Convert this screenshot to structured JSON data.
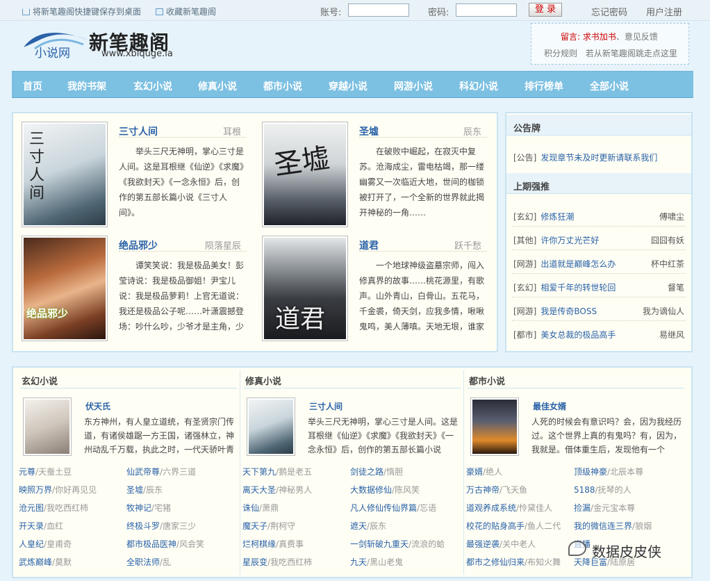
{
  "topbar": {
    "save_shortcut": "将新笔趣阁快捷键保存到桌面",
    "bookmark": "收藏新笔趣阁",
    "account_label": "账号:",
    "password_label": "密码:",
    "login_button": "登 录",
    "forgot_password": "忘记密码",
    "register": "用户注册"
  },
  "header": {
    "logo_small": "小说网",
    "logo_big": "新笔趣阁",
    "logo_url": "www.xbiquge.la",
    "notice_label": "留言:",
    "notice_link1": "求书加书",
    "notice_sep": "、",
    "notice_link2": "意见反馈",
    "notice_line2_a": "积分规则",
    "notice_line2_b": "若从新笔趣阁跳走点这里"
  },
  "nav": [
    "首页",
    "我的书架",
    "玄幻小说",
    "修真小说",
    "都市小说",
    "穿越小说",
    "网游小说",
    "科幻小说",
    "排行榜单",
    "全部小说"
  ],
  "featured": [
    {
      "title": "三寸人间",
      "author": "耳根",
      "desc": "举头三尺无神明，掌心三寸是人间。这是耳根继《仙逆》《求魔》《我欲封天》《一念永恒》后，创作的第五部长篇小说《三寸人间》。"
    },
    {
      "title": "圣墟",
      "author": "辰东",
      "desc": "在破败中崛起，在寂灭中复苏。沧海成尘，雷电枯竭，那一缕幽雾又一次临近大地，世间的枷锁被打开了，一个全新的世界就此揭开神秘的一角……"
    },
    {
      "title": "绝品邪少",
      "author": "陨落星辰",
      "desc": "谭笑笑说：我是极品美女！彭莹诗说：我是极品御姐！尹宝儿说：我是极品萝莉！上官无道说：我还是极品公子呢……叶潇震撼登场：吵什么吵，少爷才是主角，少爷的口号是践踏一切极品，只做人"
    },
    {
      "title": "道君",
      "author": "跃千愁",
      "desc": "一个地球神级盗墓宗师，闯入修真界的故事……桃花源里，有歌声。山外青山，白骨山。五花马，千金裘，倚天剑，应我多情，啾啾鬼鸣，美人薄嗔。天地无垠，谁家旗鼓，碧落黄泉，万古高楼。为义"
    }
  ],
  "side": {
    "notice_title": "公告牌",
    "notice_cat": "[公告]",
    "notice_text": "发现章节未及时更新请联系我们",
    "recommend_title": "上期强推",
    "items": [
      {
        "cat": "[玄幻]",
        "name": "修炼狂潮",
        "author": "傅啸尘"
      },
      {
        "cat": "[其他]",
        "name": "许你万丈光芒好",
        "author": "囧囧有妖"
      },
      {
        "cat": "[网游]",
        "name": "出道就是巅峰怎么办",
        "author": "杯中红茶"
      },
      {
        "cat": "[玄幻]",
        "name": "相爱千年的转世轮回",
        "author": "督笔"
      },
      {
        "cat": "[网游]",
        "name": "我是传奇BOSS",
        "author": "我为谪仙人"
      },
      {
        "cat": "[都市]",
        "name": "美女总裁的极品高手",
        "author": "易继风"
      }
    ]
  },
  "categories": [
    {
      "title": "玄幻小说",
      "top_title": "伏天氏",
      "top_desc": "东方神州，有人皇立道统，有圣贤宗门传道，有诸侯雄踞一方王国，诸强林立，神州动乱千万载，执此之时，一代天骄叶青",
      "rows": [
        [
          {
            "b": "元尊",
            "a": "天蚕土豆"
          },
          {
            "b": "仙武帝尊",
            "a": "六界三道"
          }
        ],
        [
          {
            "b": "映照万界",
            "a": "你好再见见"
          },
          {
            "b": "圣墟",
            "a": "辰东"
          }
        ],
        [
          {
            "b": "沧元图",
            "a": "我吃西红柿"
          },
          {
            "b": "牧神记",
            "a": "宅猪"
          }
        ],
        [
          {
            "b": "开天录",
            "a": "血红"
          },
          {
            "b": "终极斗罗",
            "a": "唐家三少"
          }
        ],
        [
          {
            "b": "人皇纪",
            "a": "皇甫奇"
          },
          {
            "b": "都市极品医神",
            "a": "风会笑"
          }
        ],
        [
          {
            "b": "武炼巅峰",
            "a": "莫默"
          },
          {
            "b": "全职法师",
            "a": "乱"
          }
        ]
      ]
    },
    {
      "title": "修真小说",
      "top_title": "三寸人间",
      "top_desc": "举头三尺无神明，掌心三寸是人间。这是耳根继《仙逆》《求魔》《我欲封天》《一念永恒》后，创作的第五部长篇小说",
      "rows": [
        [
          {
            "b": "天下第九",
            "a": "鹅是老五"
          },
          {
            "b": "剑徒之路",
            "a": "惰胆"
          }
        ],
        [
          {
            "b": "离天大圣",
            "a": "神秘男人"
          },
          {
            "b": "大数据修仙",
            "a": "陈风笑"
          }
        ],
        [
          {
            "b": "诛仙",
            "a": "萧鼎"
          },
          {
            "b": "凡人修仙传仙界篇",
            "a": "忘语"
          }
        ],
        [
          {
            "b": "魔天子",
            "a": "荆柯守"
          },
          {
            "b": "遮天",
            "a": "辰东"
          }
        ],
        [
          {
            "b": "烂柯棋缘",
            "a": "真费事"
          },
          {
            "b": "一剑斩破九重天",
            "a": "流浪的蛤"
          }
        ],
        [
          {
            "b": "星辰变",
            "a": "我吃西红柿"
          },
          {
            "b": "九天",
            "a": "黑山老鬼"
          }
        ]
      ]
    },
    {
      "title": "都市小说",
      "top_title": "最佳女婿",
      "top_desc": "人死的时候会有意识吗？会，因为我经历过。这个世界上真的有鬼吗？有，因为，我就是。借体重生后，发现他有一个",
      "rows": [
        [
          {
            "b": "豪婿",
            "a": "绝人"
          },
          {
            "b": "顶级神豪",
            "a": "北辰本尊"
          }
        ],
        [
          {
            "b": "万古神帝",
            "a": "飞天鱼"
          },
          {
            "b": "5188",
            "a": "抚琴的人"
          }
        ],
        [
          {
            "b": "道观养成系统",
            "a": "怜黛佳人"
          },
          {
            "b": "捡漏",
            "a": "金元宝本尊"
          }
        ],
        [
          {
            "b": "校花的贴身高手",
            "a": "鱼人二代"
          },
          {
            "b": "我的微信连三界",
            "a": "狼烟"
          }
        ],
        [
          {
            "b": "最强逆袭",
            "a": "关中老人"
          },
          {
            "b": "直播",
            "a": ""
          }
        ],
        [
          {
            "b": "都市之修仙归来",
            "a": "布知火舞"
          },
          {
            "b": "天降巨富",
            "a": "陆原居"
          }
        ]
      ]
    }
  ],
  "watermark": "数据皮皮侠"
}
